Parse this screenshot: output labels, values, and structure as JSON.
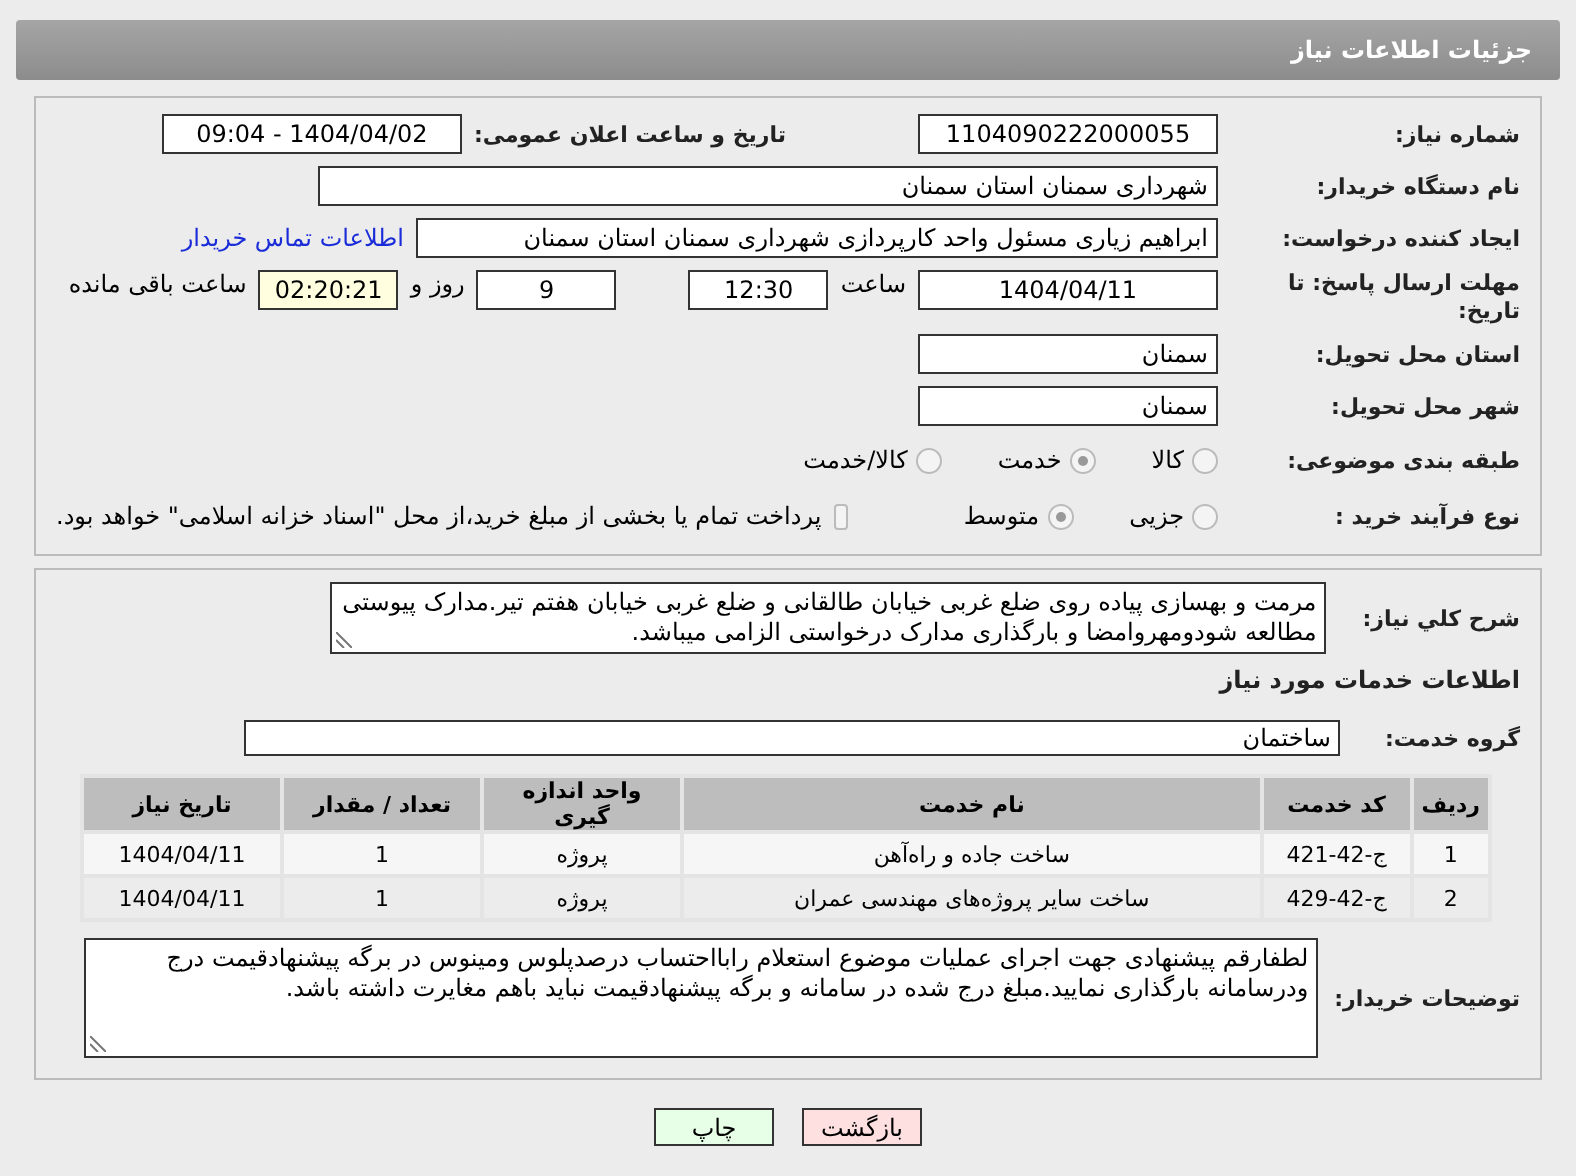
{
  "header": {
    "title": "جزئیات اطلاعات نیاز"
  },
  "info": {
    "need_number": {
      "label": "شماره نیاز:",
      "value": "1104090222000055"
    },
    "announce": {
      "label": "تاریخ و ساعت اعلان عمومی:",
      "value": "1404/04/02 - 09:04"
    },
    "buyer_org": {
      "label": "نام دستگاه خریدار:",
      "value": "شهرداری سمنان استان سمنان"
    },
    "requester": {
      "label": "ایجاد کننده درخواست:",
      "value": "ابراهیم زیاری مسئول واحد کارپردازی شهرداری سمنان استان سمنان",
      "link": "اطلاعات تماس خریدار"
    },
    "deadline": {
      "label": "مهلت ارسال پاسخ: تا تاریخ:",
      "date": "1404/04/11",
      "time_label": "ساعت",
      "time": "12:30",
      "days": "9",
      "days_label": "روز و",
      "remaining": "02:20:21",
      "remaining_label": "ساعت باقی مانده"
    },
    "province": {
      "label": "استان محل تحویل:",
      "value": "سمنان"
    },
    "city": {
      "label": "شهر محل تحویل:",
      "value": "سمنان"
    },
    "category": {
      "label": "طبقه بندی موضوعی:",
      "options": [
        {
          "label": "کالا",
          "selected": false
        },
        {
          "label": "خدمت",
          "selected": true
        },
        {
          "label": "کالا/خدمت",
          "selected": false
        }
      ]
    },
    "process": {
      "label": "نوع فرآیند خرید :",
      "options": [
        {
          "label": "جزیی",
          "selected": false
        },
        {
          "label": "متوسط",
          "selected": true
        }
      ],
      "payment": {
        "label": "پرداخت تمام یا بخشی از مبلغ خرید،از محل \"اسناد خزانه اسلامی\" خواهد بود.",
        "checked": false
      }
    }
  },
  "services": {
    "description": {
      "label": "شرح کلي نياز:",
      "value": "مرمت و بهسازی پیاده روی ضلع غربی خیابان طالقانی و ضلع غربی خیابان هفتم تیر.مدارک پیوستی مطالعه شودومهروامضا و بارگذاری مدارک درخواستی الزامی میباشد."
    },
    "section_title": "اطلاعات خدمات مورد نیاز",
    "service_group": {
      "label": "گروه خدمت:",
      "value": "ساختمان"
    },
    "table": {
      "columns": [
        "ردیف",
        "کد خدمت",
        "نام خدمت",
        "واحد اندازه گیری",
        "تعداد / مقدار",
        "تاریخ نیاز"
      ],
      "rows": [
        [
          "1",
          "ج-42-421",
          "ساخت جاده و راه‌آهن",
          "پروژه",
          "1",
          "1404/04/11"
        ],
        [
          "2",
          "ج-42-429",
          "ساخت سایر پروژه‌های مهندسی عمران",
          "پروژه",
          "1",
          "1404/04/11"
        ]
      ]
    },
    "buyer_notes": {
      "label": "توضیحات خریدار:",
      "value": "لطفارقم پیشنهادی جهت اجرای عملیات موضوع استعلام رابااحتساب درصدپلوس ومینوس در برگه پیشنهادقیمت درج ودرسامانه بارگذاری نمایید.مبلغ درج شده در سامانه و برگه پیشنهادقیمت نباید باهم مغایرت داشته باشد."
    }
  },
  "buttons": [
    {
      "label": "بازگشت",
      "kind": "back"
    },
    {
      "label": "چاپ",
      "kind": "print"
    }
  ]
}
